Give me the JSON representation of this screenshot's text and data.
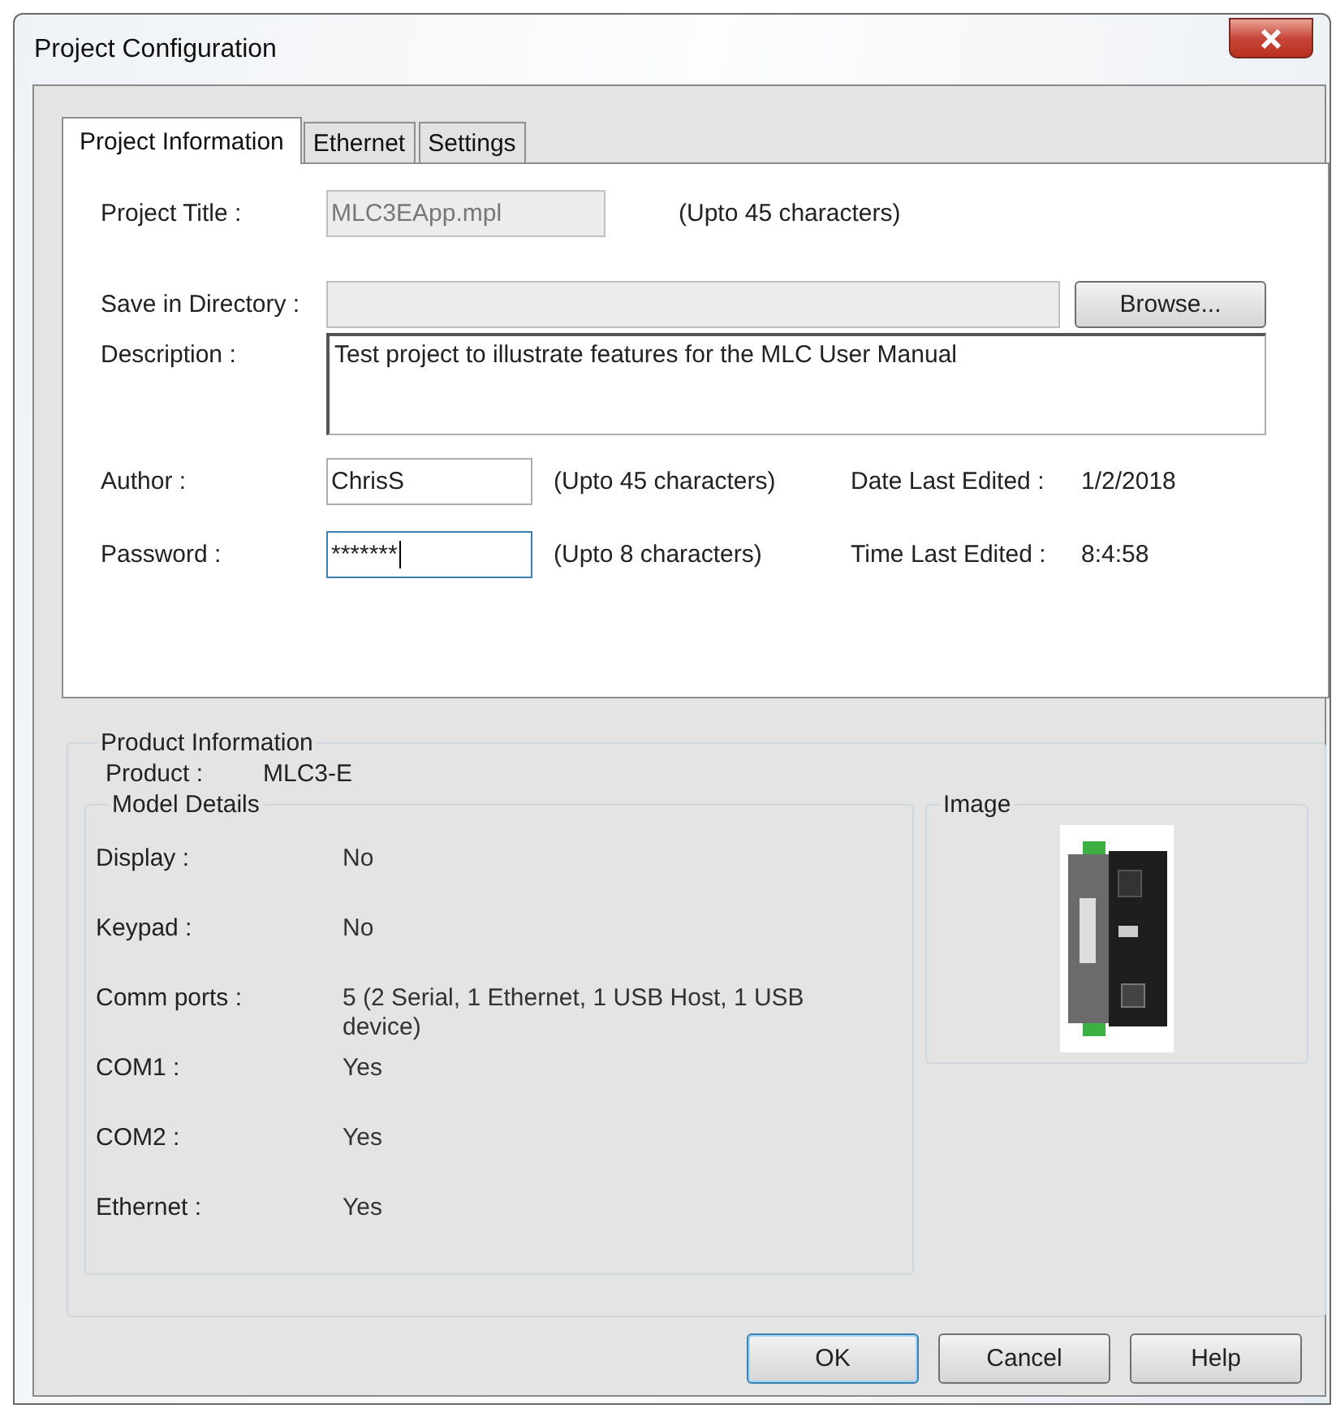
{
  "window": {
    "title": "Project Configuration"
  },
  "tabs": [
    {
      "label": "Project Information",
      "selected": true
    },
    {
      "label": "Ethernet",
      "selected": false
    },
    {
      "label": "Settings",
      "selected": false
    }
  ],
  "project_title": {
    "label": "Project Title :",
    "value": "MLC3EApp.mpl",
    "disabled": true,
    "note": "(Upto 45 characters)"
  },
  "save_directory": {
    "label": "Save in Directory :",
    "disabled": true,
    "button": "Browse..."
  },
  "description": {
    "label": "Description :",
    "value": "Test project to illustrate features for the MLC User Manual"
  },
  "author": {
    "label": "Author :",
    "value": "ChrisS",
    "focused": false,
    "note": "(Upto 45 characters)"
  },
  "password": {
    "label": "Password :",
    "value": "*******",
    "focused": true,
    "note": "(Upto 8 characters)"
  },
  "date_last_edited": {
    "label": "Date Last Edited :",
    "value": "1/2/2018"
  },
  "time_last_edited": {
    "label": "Time Last Edited :",
    "value": "8:4:58"
  },
  "product_information": {
    "title": "Product Information",
    "product_label": "Product :",
    "product_value": "MLC3-E",
    "model_details": {
      "title": "Model Details",
      "rows": [
        {
          "label": "Display :",
          "value": "No"
        },
        {
          "label": "Keypad :",
          "value": "No"
        },
        {
          "label": "Comm ports :",
          "value": "5 (2 Serial, 1 Ethernet, 1 USB Host, 1 USB device)"
        },
        {
          "label": "COM1 :",
          "value": "Yes"
        },
        {
          "label": "COM2 :",
          "value": "Yes"
        },
        {
          "label": "Ethernet :",
          "value": "Yes"
        }
      ]
    },
    "image": {
      "title": "Image"
    }
  },
  "buttons": [
    {
      "label": "OK",
      "default": true
    },
    {
      "label": "Cancel",
      "default": false
    },
    {
      "label": "Help",
      "default": false
    }
  ]
}
